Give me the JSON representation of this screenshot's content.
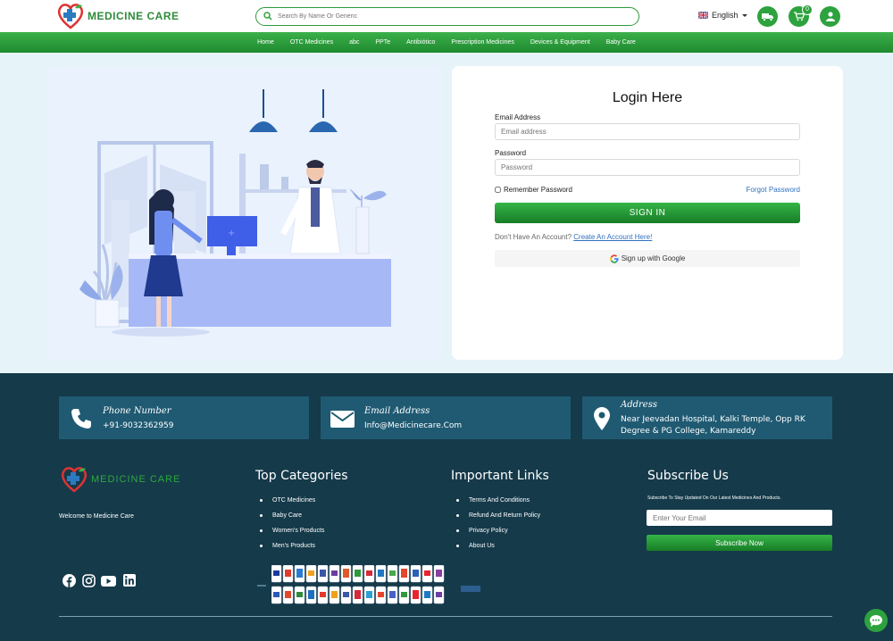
{
  "brand": {
    "name": "MEDICINE CARE"
  },
  "header": {
    "search_placeholder": "Search By Name Or Generic",
    "language": "English",
    "cart_count": "0"
  },
  "nav": {
    "items": [
      "Home",
      "OTC Medicines",
      "abc",
      "PPTe",
      "Antibiótico",
      "Prescription Medicines",
      "Devices & Equipment",
      "Baby Care"
    ]
  },
  "login": {
    "title": "Login Here",
    "email_label": "Email Address",
    "email_placeholder": "Email address",
    "password_label": "Password",
    "password_placeholder": "Password",
    "remember_label": "Remember Password",
    "forgot_label": "Forgot Password",
    "signin_label": "SIGN IN",
    "no_account_text": "Don't Have An Account?",
    "create_account_label": "Create An Account Here!",
    "google_label": "Sign up with Google"
  },
  "footer": {
    "phone": {
      "title": "Phone Number",
      "value": "+91-9032362959"
    },
    "email": {
      "title": "Email Address",
      "value": "Info@Medicinecare.Com"
    },
    "address": {
      "title": "Address",
      "line1": "Near Jeevadan Hospital, Kalki Temple, Opp RK",
      "line2": "Degree & PG College, Kamareddy"
    },
    "welcome": "Welcome to Medicine Care",
    "categories": {
      "title": "Top Categories",
      "items": [
        "OTC Medicines",
        "Baby Care",
        "Women's Products",
        "Men's Products"
      ]
    },
    "links": {
      "title": "Important Links",
      "items": [
        "Terms And Conditions",
        "Refund And Return Policy",
        "Privacy Policy",
        "About Us"
      ]
    },
    "subscribe": {
      "title": "Subscribe Us",
      "text": "Subscribe To Stay Updated On Our Latest Medicines And Products.",
      "placeholder": "Enter Your Email",
      "button": "Subscribe Now"
    },
    "social": [
      "facebook-icon",
      "instagram-icon",
      "youtube-icon",
      "linkedin-icon"
    ]
  },
  "colors": {
    "primary_green": "#2da23e",
    "footer_bg": "#153a4a",
    "footer_box": "#1f5a72",
    "page_bg": "#e6f4fa"
  }
}
